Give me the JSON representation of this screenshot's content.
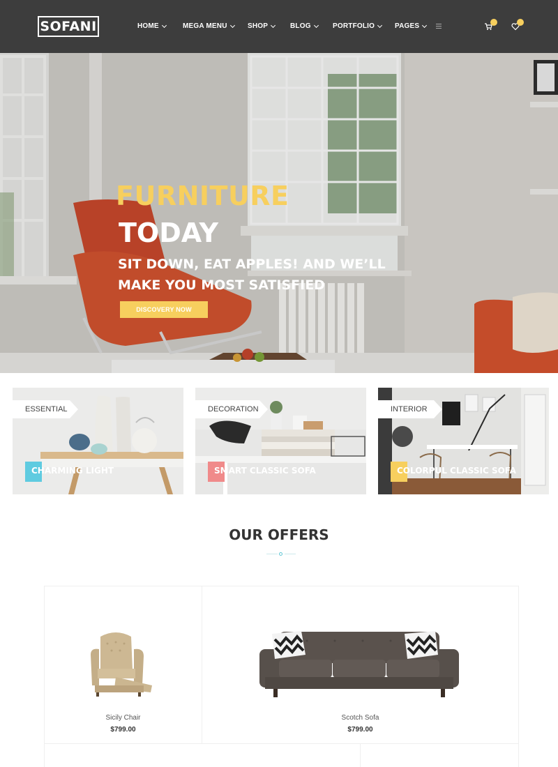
{
  "header": {
    "logo": "SOFANI",
    "nav": [
      "HOME",
      "MEGA MENU",
      "SHOP",
      "BLOG",
      "PORTFOLIO",
      "PAGES"
    ],
    "icons": [
      "menu-icon",
      "cart-icon",
      "heart-icon"
    ],
    "badge_color": "#f7cf5e"
  },
  "hero": {
    "title_line1": "FURNITURE",
    "title_line2": "TODAY",
    "subtitle": "SIT DOWN, EAT APPLES! AND WE’LL MAKE YOU MOST SATISFIED",
    "button": "DISCOVERY NOW",
    "accent": "#f7cf5e"
  },
  "categories": [
    {
      "tag": "ESSENTIAL",
      "title": "CHARMING LIGHT",
      "accent": "#5fcbe0"
    },
    {
      "tag": "DECORATION",
      "title": "SMART CLASSIC SOFA",
      "accent": "#f08a8a"
    },
    {
      "tag": "INTERIOR",
      "title": "COLORPUL CLASSIC SOFA",
      "accent": "#f7cf5e"
    }
  ],
  "offers": {
    "title": "OUR OFFERS",
    "products": [
      {
        "name": "Sicily Chair",
        "price": "$799.00"
      },
      {
        "name": "Scotch Sofa",
        "price": "$799.00"
      }
    ]
  }
}
